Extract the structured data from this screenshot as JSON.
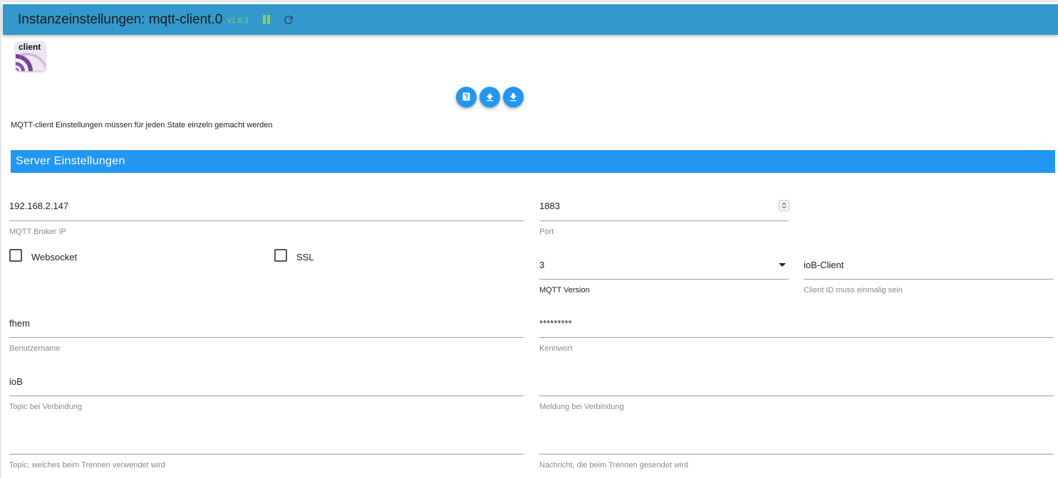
{
  "header": {
    "title": "Instanzeinstellungen: mqtt-client.0",
    "version": "v1.6.3",
    "pause_icon": "pause-icon",
    "reload_icon": "reload-icon",
    "colors": {
      "bar": "#3399cc",
      "version": "#7fd36b"
    }
  },
  "logo": {
    "text": "client"
  },
  "toolbar": {
    "help_icon": "help-icon",
    "upload_icon": "upload-icon",
    "download_icon": "download-icon"
  },
  "hint": "MQTT-client Einstellungen müssen für jeden State einzeln gemacht werden",
  "section": {
    "title": "Server Einstellungen",
    "color": "#2196f3"
  },
  "fields": {
    "broker_ip": {
      "value": "192.168.2.147",
      "label": "MQTT Broker IP"
    },
    "port": {
      "value": "1883",
      "label": "Port"
    },
    "websocket": {
      "label": "Websocket",
      "checked": false
    },
    "ssl": {
      "label": "SSL",
      "checked": false
    },
    "mqtt_version": {
      "value": "3",
      "label": "MQTT Version"
    },
    "client_id": {
      "value": "ioB-Client",
      "label": "Client ID muss einmalig sein"
    },
    "username": {
      "value": "fhem",
      "label": "Benutzername"
    },
    "password": {
      "value": "*********",
      "label": "Kennwort"
    },
    "connect_topic": {
      "value": "ioB",
      "label": "Topic bei Verbindung"
    },
    "connect_message": {
      "value": "",
      "label": "Meldung bei Verbindung"
    },
    "disconnect_topic": {
      "value": "",
      "label": "Topic, welches beim Trennen verwendet wird"
    },
    "disconnect_message": {
      "value": "",
      "label": "Nachricht, die beim Trennen gesendet wird"
    }
  }
}
